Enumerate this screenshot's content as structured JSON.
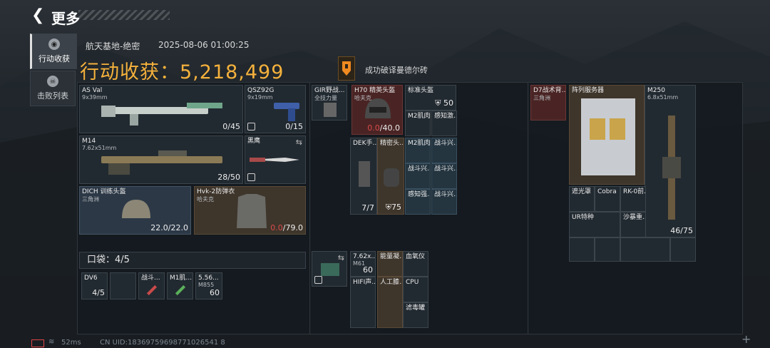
{
  "topbar": {
    "title": "更多"
  },
  "sidebar": {
    "tabs": [
      {
        "label": "行动收获",
        "active": true
      },
      {
        "label": "击败列表",
        "active": false
      }
    ]
  },
  "header": {
    "map": "航天基地-绝密",
    "datetime": "2025-08-06 01:00:25",
    "title_label": "行动收获：",
    "value": "5,218,499",
    "achievement": "成功破译曼德尔砖"
  },
  "loadout": {
    "weapons": [
      {
        "name": "AS Val",
        "caliber": "9x39mm",
        "ammo": "0/45"
      },
      {
        "name": "QSZ92G",
        "caliber": "9x19mm",
        "ammo": "0/15"
      },
      {
        "name": "M14",
        "caliber": "7.62x51mm",
        "ammo": "28/50"
      },
      {
        "name": "黑鹰",
        "caliber": "",
        "ammo": ""
      }
    ],
    "helmet": {
      "name": "DICH 训练头盔",
      "origin": "三角洲",
      "durability": "22.0/22.0"
    },
    "armor": {
      "name": "Hvk-2防弹衣",
      "origin": "哈夫克",
      "durability_current": "0.0",
      "durability_max": "/79.0"
    }
  },
  "pocket": {
    "label": "口袋：4/5",
    "items": [
      {
        "name": "DV6",
        "count": "4/5"
      },
      {
        "name": "",
        "count": ""
      },
      {
        "name": "战斗...",
        "count": ""
      },
      {
        "name": "M1肌...",
        "count": ""
      },
      {
        "name": "5.56...",
        "sub": "M855",
        "count": "60"
      }
    ]
  },
  "chest_rig": {
    "top": [
      {
        "name": "GIR野战...",
        "sub": "全技力量"
      },
      {
        "name": "H70 精英头盔",
        "sub": "哈夫克",
        "durability_current": "0.0",
        "durability_max": "/40.0"
      },
      {
        "name": "标准头盔",
        "count": "50"
      }
    ],
    "grid": [
      {
        "name": "M2肌肉..."
      },
      {
        "name": "感知激..."
      },
      {
        "name": "DEK手...",
        "count": "7/7"
      },
      {
        "name": "精密头...",
        "count": "75"
      },
      {
        "name": "M2肌肉..."
      },
      {
        "name": "战斗兴..."
      },
      {
        "name": "战斗兴..."
      },
      {
        "name": "战斗兴..."
      },
      {
        "name": "感知强..."
      },
      {
        "name": "战斗兴..."
      }
    ]
  },
  "backpack_left": {
    "items": [
      {
        "name": "7.62x...",
        "sub": "M61",
        "count": "60"
      },
      {
        "name": "能量凝..."
      },
      {
        "name": "血氧仪"
      },
      {
        "name": "HIFI声..."
      },
      {
        "name": "人工膝..."
      },
      {
        "name": "CPU"
      },
      {
        "name": "滤毒罐"
      }
    ]
  },
  "backpack_right": {
    "bag": {
      "name": "D7战术背...",
      "sub": "三角洲"
    },
    "server": {
      "name": "阵列服务器"
    },
    "gun": {
      "name": "M250",
      "caliber": "6.8x51mm",
      "ammo": "46/75"
    },
    "attachments": [
      "遮光罩",
      "Cobra",
      "RK-0前...",
      "UR特种",
      "沙暴重..."
    ]
  },
  "footer": {
    "ping": "52ms",
    "uid": "CN UID:18369759698771026541 8"
  }
}
